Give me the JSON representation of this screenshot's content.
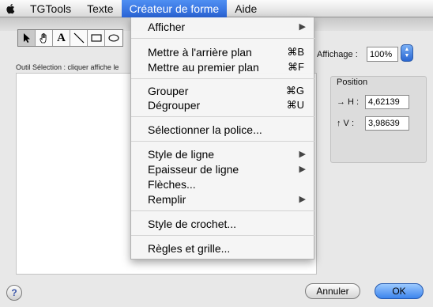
{
  "menubar": {
    "apple": "apple-icon",
    "items": [
      "TGTools",
      "Texte",
      "Créateur de forme",
      "Aide"
    ],
    "active_index": 2
  },
  "toolbar": {
    "tools": [
      "select-arrow-icon",
      "hand-icon",
      "text-icon",
      "line-icon",
      "rectangle-icon",
      "ellipse-icon"
    ],
    "text_tool_glyph": "A"
  },
  "hint": "Outil Sélection : cliquer affiche le",
  "zoom": {
    "label": "Affichage :",
    "value": "100%"
  },
  "position": {
    "title": "Position",
    "h_label": "→ H :",
    "h_value": "4,62139",
    "v_label": "↑ V :",
    "v_value": "3,98639"
  },
  "buttons": {
    "help": "?",
    "cancel": "Annuler",
    "ok": "OK"
  },
  "menu": {
    "items": [
      {
        "label": "Afficher",
        "submenu": true
      },
      {
        "label": "Mettre à l'arrière plan",
        "shortcut": "⌘B"
      },
      {
        "label": "Mettre au premier plan",
        "shortcut": "⌘F"
      },
      {
        "label": "Grouper",
        "shortcut": "⌘G"
      },
      {
        "label": "Dégrouper",
        "shortcut": "⌘U"
      },
      {
        "label": "Sélectionner la police..."
      },
      {
        "label": "Style de ligne",
        "submenu": true
      },
      {
        "label": "Epaisseur de ligne",
        "submenu": true
      },
      {
        "label": "Flèches..."
      },
      {
        "label": "Remplir",
        "submenu": true
      },
      {
        "label": "Style de crochet..."
      },
      {
        "label": "Règles et grille..."
      }
    ]
  },
  "colors": {
    "menu_highlight": "#2a64d6",
    "ok_button": "#3c84ec"
  }
}
